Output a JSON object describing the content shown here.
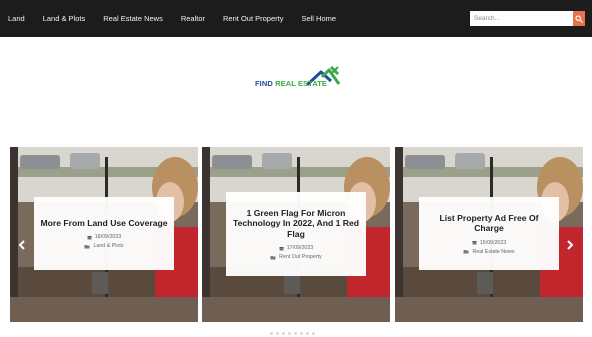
{
  "nav": {
    "items": [
      "Land",
      "Land & Plots",
      "Real Estate News",
      "Realtor",
      "Rent Out Property",
      "Sell Home"
    ]
  },
  "search": {
    "placeholder": "Search..."
  },
  "logo": {
    "word1": "FIND ",
    "word2": "REAL ESTATE"
  },
  "slides": [
    {
      "title": "More From Land Use Coverage",
      "date": "18/09/2023",
      "category": "Land & Plots"
    },
    {
      "title": "1 Green Flag For Micron Technology In 2022, And 1 Red Flag",
      "date": "17/09/2023",
      "category": "Rent Out Property"
    },
    {
      "title": "List Property Ad Free Of Charge",
      "date": "15/09/2023",
      "category": "Real Estate News"
    }
  ],
  "colors": {
    "nav_bg": "#1c1c1c",
    "search_button": "#e8734a",
    "logo_blue": "#1e4f9e",
    "logo_green": "#3aa84a"
  }
}
